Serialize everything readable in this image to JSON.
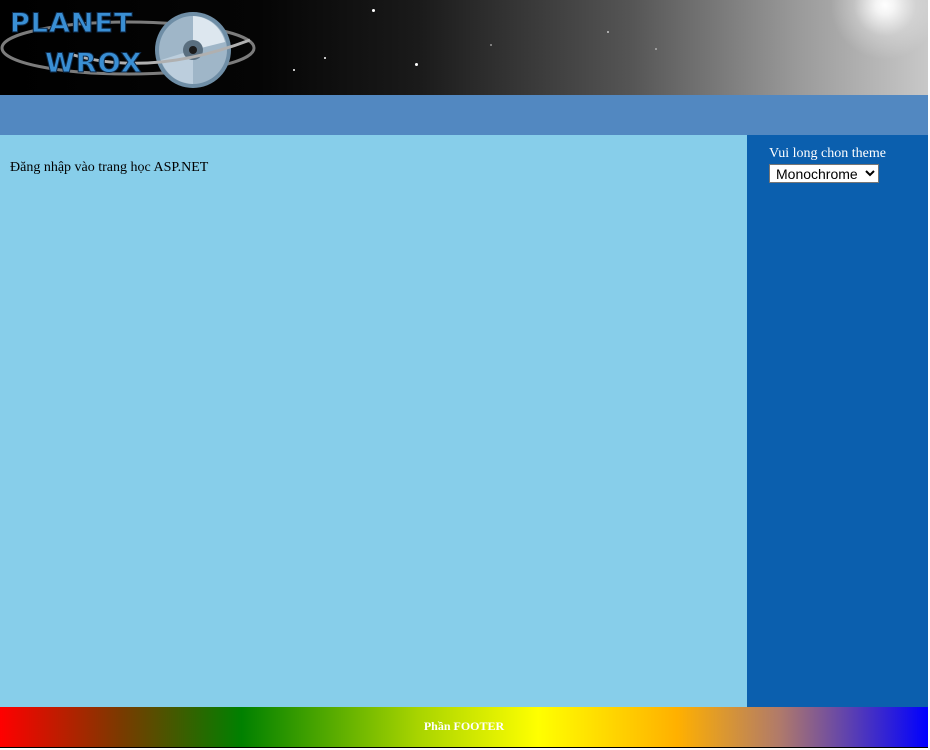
{
  "header": {
    "logo_text": "PLANET WROX"
  },
  "main": {
    "intro_text": "Đăng nhập vào trang học ASP.NET"
  },
  "sidebar": {
    "theme_label": "Vui long chon theme",
    "theme_selected": "Monochrome"
  },
  "footer": {
    "text": "Phần FOOTER"
  },
  "colors": {
    "menu_bar": "#5288c1",
    "main_background": "#87ceea",
    "sidebar_background": "#0b5fae"
  }
}
